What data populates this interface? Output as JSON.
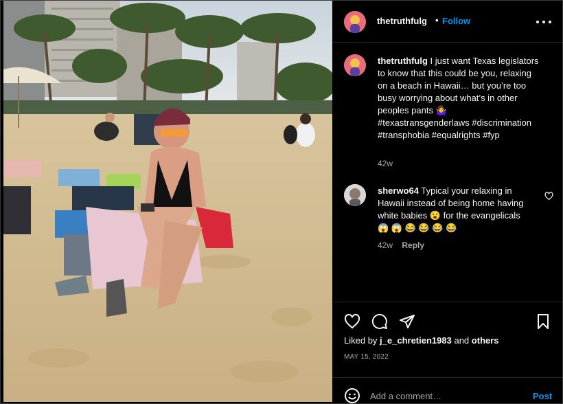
{
  "post": {
    "author": "thetruthfulg",
    "separator": "•",
    "follow_label": "Follow",
    "caption": "I just want Texas legislators to know that this could be you, relaxing on a beach in Hawaii… but you’re too busy worrying about what’s in other peoples pants 🤷‍♀️ #texastransgenderlaws #discrimination #transphobia #equalrights #fyp",
    "caption_time": "42w"
  },
  "comments": [
    {
      "author": "sherwo64",
      "text": "Typical your relaxing in Hawaii instead of being home having white babies 😮 for the evangelicals 😱 😱 😂 😂 😂 😂",
      "time": "42w",
      "reply_label": "Reply"
    }
  ],
  "likes": {
    "prefix": "Liked by",
    "user": "j_e_chretien1983",
    "and": "and",
    "others": "others"
  },
  "date": "MAY 15, 2022",
  "add_comment": {
    "placeholder": "Add a comment…",
    "post_label": "Post"
  },
  "icons": {
    "like": "heart-icon",
    "comment": "comment-icon",
    "share": "paper-plane-icon",
    "save": "bookmark-icon",
    "more": "more-horizontal-icon",
    "emoji": "smiley-icon"
  },
  "colors": {
    "accent": "#0095f6",
    "background": "#000000",
    "text": "#f5f5f5",
    "muted": "#a8a8a8",
    "divider": "#262626"
  }
}
